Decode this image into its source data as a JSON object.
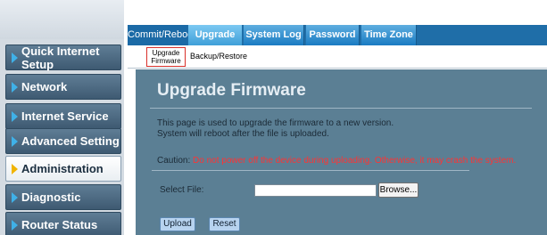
{
  "sidebar": {
    "items": [
      {
        "label": "Quick Internet Setup",
        "active": false
      },
      {
        "label": "Network",
        "active": false
      },
      {
        "label": "Internet Service",
        "active": false
      },
      {
        "label": "Advanced Setting",
        "active": false
      },
      {
        "label": "Administration",
        "active": true
      },
      {
        "label": "Diagnostic",
        "active": false
      },
      {
        "label": "Router Status",
        "active": false
      }
    ]
  },
  "tabs": [
    {
      "label": "Commit/Reboot",
      "active": false
    },
    {
      "label": "Upgrade",
      "active": true
    },
    {
      "label": "System Log",
      "active": false
    },
    {
      "label": "Password",
      "active": false
    },
    {
      "label": "Time Zone",
      "active": false
    }
  ],
  "subtabs": {
    "active_label_line1": "Upgrade",
    "active_label_line2": "Firmware",
    "other_label": "Backup/Restore"
  },
  "main": {
    "title": "Upgrade Firmware",
    "description_line1": "This page is used to upgrade the firmware to a new version.",
    "description_line2": "System will reboot after the file is uploaded.",
    "caution_label": "Caution:",
    "caution_text": "Do not power off the device during uploading. Otherwise, it may crash the system.",
    "select_file_label": "Select File:",
    "file_value": "",
    "browse_label": "Browse...",
    "upload_label": "Upload",
    "reset_label": "Reset"
  },
  "colors": {
    "tabbar": "#1f6ea8",
    "content_bg": "#5b7f94",
    "caution_text": "#ff3333",
    "nav_bg": "#4a677f"
  }
}
